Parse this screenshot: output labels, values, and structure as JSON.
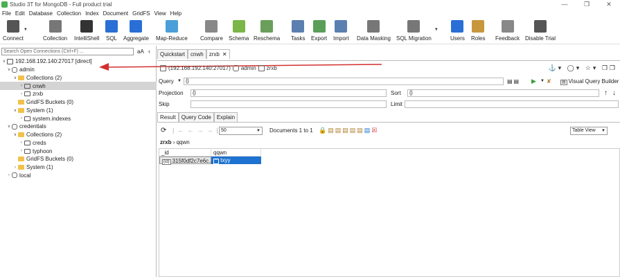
{
  "window": {
    "title": "Studio 3T for MongoDB - Full product trial"
  },
  "menu": [
    "File",
    "Edit",
    "Database",
    "Collection",
    "Index",
    "Document",
    "GridFS",
    "View",
    "Help"
  ],
  "toolbar": [
    {
      "label": "Connect",
      "icon": "connect-icon",
      "color": "#555555"
    },
    {
      "label": "Collection",
      "icon": "collection-icon",
      "color": "#777777"
    },
    {
      "label": "IntelliShell",
      "icon": "intellishell-icon",
      "color": "#333333"
    },
    {
      "label": "SQL",
      "icon": "sql-icon",
      "color": "#2a6fd6"
    },
    {
      "label": "Aggregate",
      "icon": "aggregate-icon",
      "color": "#2a6fd6"
    },
    {
      "label": "Map-Reduce",
      "icon": "map-reduce-icon",
      "color": "#4a9fd8"
    },
    {
      "label": "Compare",
      "icon": "compare-icon",
      "color": "#888888"
    },
    {
      "label": "Schema",
      "icon": "schema-icon",
      "color": "#7ab648"
    },
    {
      "label": "Reschema",
      "icon": "reschema-icon",
      "color": "#6a9e5a"
    },
    {
      "label": "Tasks",
      "icon": "tasks-icon",
      "color": "#5a7fb0"
    },
    {
      "label": "Export",
      "icon": "export-icon",
      "color": "#5a9e5a"
    },
    {
      "label": "Import",
      "icon": "import-icon",
      "color": "#5a7fb0"
    },
    {
      "label": "Data Masking",
      "icon": "data-masking-icon",
      "color": "#777777"
    },
    {
      "label": "SQL Migration",
      "icon": "sql-migration-icon",
      "color": "#777777"
    },
    {
      "label": "Users",
      "icon": "users-icon",
      "color": "#2a6fd6"
    },
    {
      "label": "Roles",
      "icon": "roles-icon",
      "color": "#c8963c"
    },
    {
      "label": "Feedback",
      "icon": "feedback-icon",
      "color": "#888888"
    },
    {
      "label": "Disable Trial",
      "icon": "disable-trial-icon",
      "color": "#555555"
    }
  ],
  "sidebar": {
    "search_placeholder": "Search Open Connections (Ctrl+F) ...",
    "aa_label": "aA",
    "tree": [
      {
        "label": "192.168.192.140:27017 [direct]",
        "icon": "server-icon"
      },
      {
        "label": "admin",
        "icon": "database-icon"
      },
      {
        "label": "Collections (2)",
        "icon": "folder-icon"
      },
      {
        "label": "cnwh",
        "icon": "collection-icon"
      },
      {
        "label": "zrxb",
        "icon": "collection-icon"
      },
      {
        "label": "GridFS Buckets (0)",
        "icon": "folder-icon"
      },
      {
        "label": "System (1)",
        "icon": "folder-icon"
      },
      {
        "label": "system.indexes",
        "icon": "collection-icon"
      },
      {
        "label": "credentials",
        "icon": "database-icon"
      },
      {
        "label": "Collections (2)",
        "icon": "folder-icon"
      },
      {
        "label": "creds",
        "icon": "collection-icon"
      },
      {
        "label": "typhoon",
        "icon": "collection-icon"
      },
      {
        "label": "GridFS Buckets (0)",
        "icon": "folder-icon"
      },
      {
        "label": "System (1)",
        "icon": "folder-icon"
      },
      {
        "label": "local",
        "icon": "database-icon"
      }
    ]
  },
  "tabs": [
    {
      "label": "Quickstart",
      "closable": false
    },
    {
      "label": "cnwh",
      "closable": false
    },
    {
      "label": "zrxb",
      "closable": true
    }
  ],
  "breadcrumb": {
    "server": "(192.168.192.140:27017)",
    "db": "admin",
    "collection": "zrxb"
  },
  "query": {
    "query_label": "Query",
    "query_value": "{}",
    "projection_label": "Projection",
    "projection_value": "{}",
    "sort_label": "Sort",
    "sort_value": "{}",
    "skip_label": "Skip",
    "skip_value": "",
    "limit_label": "Limit",
    "limit_value": "",
    "vqb_label": "Visual Query Builder"
  },
  "result_tabs": [
    "Result",
    "Query Code",
    "Explain"
  ],
  "result": {
    "page_size": "50",
    "documents_label": "Documents 1 to 1",
    "view_label": "Table View",
    "path_db": "zrxb",
    "path_coll": "qqwn",
    "columns": [
      "_id",
      "qqwn"
    ],
    "row": {
      "id": "315f0df2c7e6c...",
      "id_badge": "(id)",
      "value": "txyy",
      "value_badge": "\"\""
    }
  },
  "colors": {
    "accent": "#1e72d0",
    "arrow": "#d32f2f",
    "folder": "#f0c24b",
    "selection": "#d4d4d4"
  }
}
